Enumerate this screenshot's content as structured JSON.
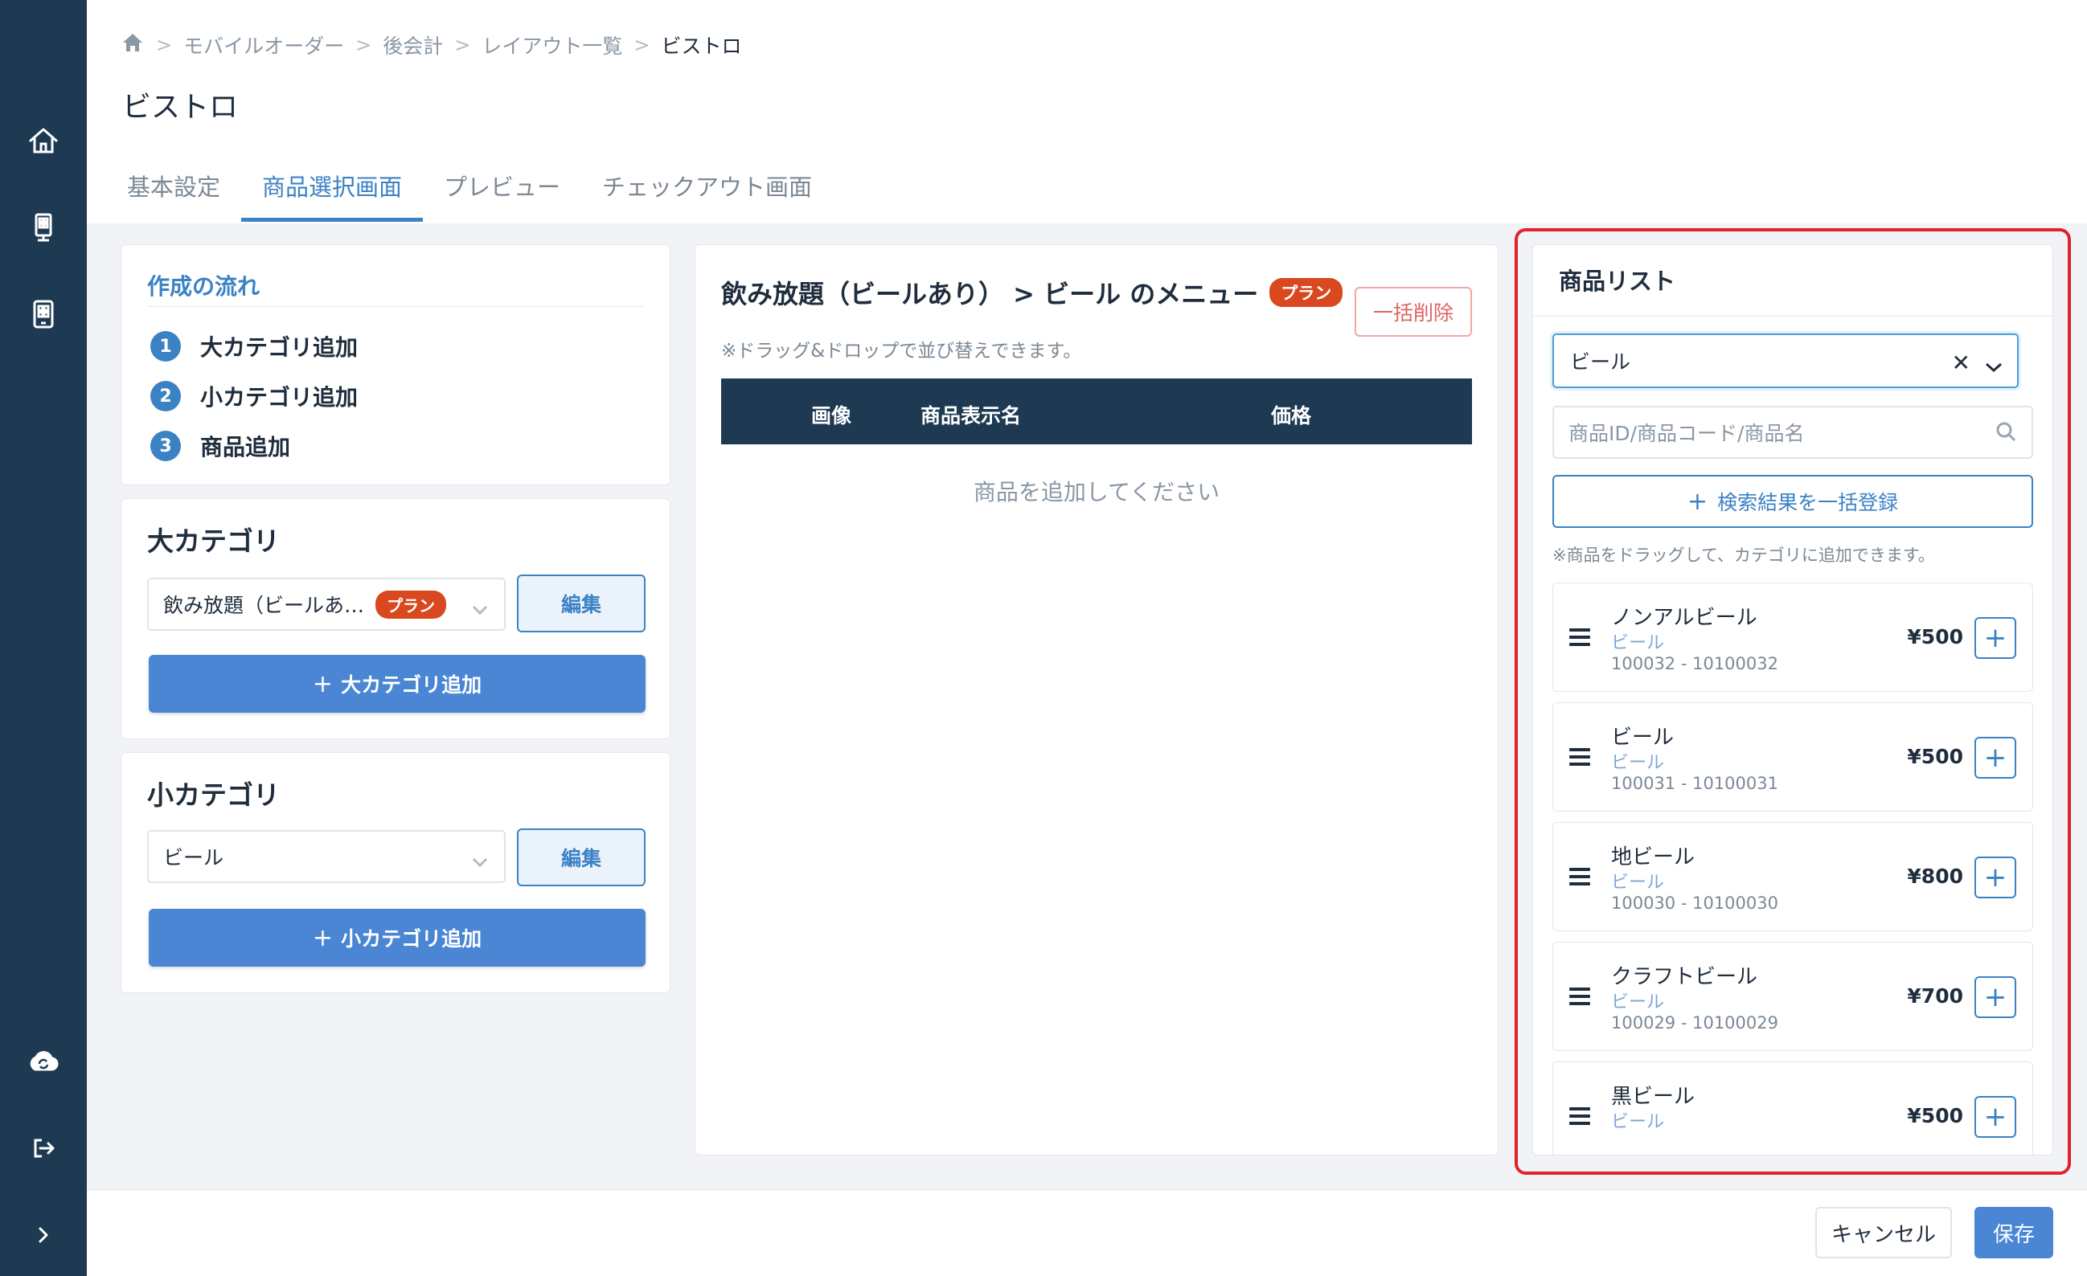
{
  "sidebar": {
    "icons": [
      "home-icon",
      "kiosk-icon",
      "tablet-icon",
      "cloud-sync-icon",
      "logout-icon",
      "chevron-right-icon"
    ]
  },
  "breadcrumb": {
    "items": [
      "モバイルオーダー",
      "後会計",
      "レイアウト一覧"
    ],
    "current": "ビストロ"
  },
  "page_title": "ビストロ",
  "tabs": [
    "基本設定",
    "商品選択画面",
    "プレビュー",
    "チェックアウト画面"
  ],
  "active_tab": "商品選択画面",
  "flow": {
    "title": "作成の流れ",
    "steps": [
      {
        "num": "1",
        "label": "大カテゴリ追加"
      },
      {
        "num": "2",
        "label": "小カテゴリ追加"
      },
      {
        "num": "3",
        "label": "商品追加"
      }
    ]
  },
  "major_category": {
    "title": "大カテゴリ",
    "selected": "飲み放題（ビールあ…",
    "badge": "プラン",
    "edit_label": "編集",
    "add_label": "大カテゴリ追加"
  },
  "minor_category": {
    "title": "小カテゴリ",
    "selected": "ビール",
    "edit_label": "編集",
    "add_label": "小カテゴリ追加"
  },
  "menu_panel": {
    "title": "飲み放題（ビールあり） > ビール のメニュー",
    "badge": "プラン",
    "delete_all_label": "一括削除",
    "note": "※ドラッグ&ドロップで並び替えできます。",
    "columns": [
      "画像",
      "商品表示名",
      "価格"
    ],
    "empty_message": "商品を追加してください"
  },
  "product_list": {
    "title": "商品リスト",
    "filter_value": "ビール",
    "search_placeholder": "商品ID/商品コード/商品名",
    "bulk_register_label": "検索結果を一括登録",
    "note": "※商品をドラッグして、カテゴリに追加できます。",
    "items": [
      {
        "name": "ノンアルビール",
        "category": "ビール",
        "code": "100032 - 10100032",
        "price": "¥500"
      },
      {
        "name": "ビール",
        "category": "ビール",
        "code": "100031 - 10100031",
        "price": "¥500"
      },
      {
        "name": "地ビール",
        "category": "ビール",
        "code": "100030 - 10100030",
        "price": "¥800"
      },
      {
        "name": "クラフトビール",
        "category": "ビール",
        "code": "100029 - 10100029",
        "price": "¥700"
      },
      {
        "name": "黒ビール",
        "category": "ビール",
        "code": "",
        "price": "¥500"
      }
    ]
  },
  "footer": {
    "cancel_label": "キャンセル",
    "save_label": "保存"
  },
  "colors": {
    "sidebar": "#1d3a52",
    "accent": "#3b82c4",
    "primary_button": "#4a86d4",
    "badge": "#d9481e",
    "highlight_frame": "#e0232b"
  }
}
